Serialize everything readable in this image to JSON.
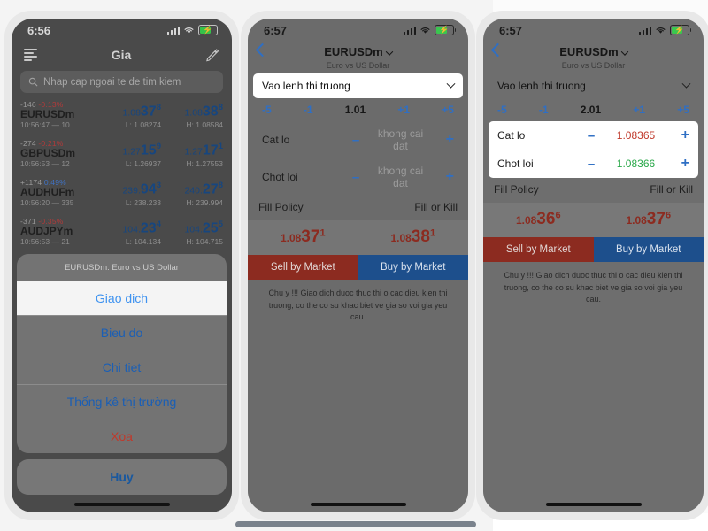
{
  "phone1": {
    "status": {
      "time": "6:56",
      "signal_icon": "cellular-bars-icon",
      "wifi_icon": "wifi-icon",
      "battery_icon": "battery-charging-icon"
    },
    "nav": {
      "menu_icon": "list-menu-icon",
      "title": "Gia",
      "edit_icon": "pencil-icon"
    },
    "search": {
      "icon": "search-icon",
      "placeholder": "Nhap cap ngoai te de tim kiem",
      "value": ""
    },
    "quotes": [
      {
        "points": "-146",
        "percent": "-0.13%",
        "direction": "neg",
        "symbol": "EURUSDm",
        "time": "10:56:47",
        "spread": "10",
        "bid": {
          "small": "1.08",
          "big": "37",
          "sup": "8"
        },
        "ask": {
          "small": "1.08",
          "big": "38",
          "sup": "8"
        },
        "low": "L: 1.08274",
        "high": "H: 1.08584"
      },
      {
        "points": "-274",
        "percent": "-0.21%",
        "direction": "neg",
        "symbol": "GBPUSDm",
        "time": "10:56:53",
        "spread": "12",
        "bid": {
          "small": "1.27",
          "big": "15",
          "sup": "9"
        },
        "ask": {
          "small": "1.27",
          "big": "17",
          "sup": "1"
        },
        "low": "L: 1.26937",
        "high": "H: 1.27553"
      },
      {
        "points": "+1174",
        "percent": "0.49%",
        "direction": "pos",
        "symbol": "AUDHUFm",
        "time": "10:56:20",
        "spread": "335",
        "bid": {
          "small": "239.",
          "big": "94",
          "sup": "3"
        },
        "ask": {
          "small": "240.",
          "big": "27",
          "sup": "8"
        },
        "low": "L: 238.233",
        "high": "H: 239.994"
      },
      {
        "points": "-371",
        "percent": "-0.35%",
        "direction": "neg",
        "symbol": "AUDJPYm",
        "time": "10:56:53",
        "spread": "21",
        "bid": {
          "small": "104.",
          "big": "23",
          "sup": "4"
        },
        "ask": {
          "small": "104.",
          "big": "25",
          "sup": "5"
        },
        "low": "L: 104.134",
        "high": "H: 104.715"
      }
    ],
    "action_sheet": {
      "header": "EURUSDm: Euro vs US Dollar",
      "items": [
        {
          "label": "Giao dich",
          "style": "active"
        },
        {
          "label": "Bieu do",
          "style": "default"
        },
        {
          "label": "Chi tiet",
          "style": "default"
        },
        {
          "label": "Thống kê thị trường",
          "style": "default"
        },
        {
          "label": "Xoa",
          "style": "destructive"
        }
      ],
      "cancel": "Huy"
    }
  },
  "phone2": {
    "status": {
      "time": "6:57",
      "signal_icon": "cellular-bars-icon",
      "wifi_icon": "wifi-icon",
      "battery_icon": "battery-charging-icon"
    },
    "nav": {
      "back_icon": "chevron-left-icon",
      "title": "EURUSDm",
      "title_caret_icon": "chevron-down-icon",
      "subtitle": "Euro vs US Dollar"
    },
    "order_type": {
      "value": "Vao lenh thi truong",
      "caret_icon": "chevron-down-icon",
      "highlighted": true
    },
    "volume": {
      "minus5": "-5",
      "minus1": "-1",
      "value": "1.01",
      "plus1": "+1",
      "plus5": "+5"
    },
    "stop_loss": {
      "label": "Cat lo",
      "minus": "–",
      "value": "khong cai dat",
      "value_state": "unset",
      "plus": "+"
    },
    "take_profit": {
      "label": "Chot loi",
      "minus": "–",
      "value": "khong cai dat",
      "value_state": "unset",
      "plus": "+"
    },
    "fill_policy": {
      "label": "Fill Policy",
      "value": "Fill or Kill"
    },
    "bid": {
      "small": "1.08",
      "big": "37",
      "sup": "1"
    },
    "ask": {
      "small": "1.08",
      "big": "38",
      "sup": "1"
    },
    "sell_button": "Sell by Market",
    "buy_button": "Buy by Market",
    "warning": "Chu y !!! Giao dich duoc thuc thi o cac dieu kien thi truong, co the co su khac biet ve gia so voi gia yeu cau."
  },
  "phone3": {
    "status": {
      "time": "6:57",
      "signal_icon": "cellular-bars-icon",
      "wifi_icon": "wifi-icon",
      "battery_icon": "battery-charging-icon"
    },
    "nav": {
      "back_icon": "chevron-left-icon",
      "title": "EURUSDm",
      "title_caret_icon": "chevron-down-icon",
      "subtitle": "Euro vs US Dollar"
    },
    "order_type": {
      "value": "Vao lenh thi truong",
      "caret_icon": "chevron-down-icon",
      "highlighted": false
    },
    "volume": {
      "minus5": "-5",
      "minus1": "-1",
      "value": "2.01",
      "plus1": "+1",
      "plus5": "+5"
    },
    "stop_loss": {
      "label": "Cat lo",
      "minus": "–",
      "value": "1.08365",
      "value_state": "redv",
      "plus": "+"
    },
    "take_profit": {
      "label": "Chot loi",
      "minus": "–",
      "value": "1.08366",
      "value_state": "greenv",
      "plus": "+"
    },
    "fill_policy": {
      "label": "Fill Policy",
      "value": "Fill or Kill"
    },
    "bid": {
      "small": "1.08",
      "big": "36",
      "sup": "6"
    },
    "ask": {
      "small": "1.08",
      "big": "37",
      "sup": "6"
    },
    "sell_button": "Sell by Market",
    "buy_button": "Buy by Market",
    "warning": "Chu y !!! Giao dich duoc thuc thi o cac dieu kien thi truong, co the co su khac biet ve gia so voi gia yeu cau."
  },
  "colors": {
    "accent_blue": "#2f6fc4",
    "sell_red": "#8c2b20",
    "buy_blue": "#1d4f8c",
    "price_blue": "#17467f",
    "positive": "#3f72c4",
    "negative": "#b33a3a",
    "green": "#2aa84a"
  }
}
